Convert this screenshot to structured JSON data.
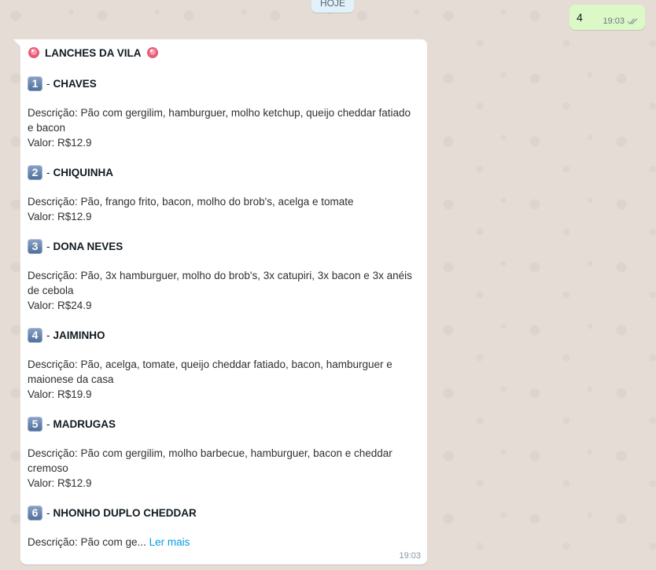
{
  "date_separator": "HOJE",
  "outgoing": {
    "text": "4",
    "time": "19:03",
    "status_icon": "double-check-icon"
  },
  "incoming": {
    "header": "LANCHES DA VILA",
    "header_icon": "siren-icon",
    "items": [
      {
        "number": "1",
        "dash": "-",
        "name": "CHAVES",
        "description": "Descrição: Pão com gergilim, hamburguer, molho ketchup, queijo cheddar fatiado e bacon",
        "price": "Valor: R$12.9"
      },
      {
        "number": "2",
        "dash": "-",
        "name": "CHIQUINHA",
        "description": "Descrição: Pão, frango frito, bacon, molho do brob's, acelga e tomate",
        "price": "Valor: R$12.9"
      },
      {
        "number": "3",
        "dash": "-",
        "name": "DONA NEVES",
        "description": "Descrição: Pão, 3x hamburguer, molho do brob's, 3x catupiri, 3x bacon e 3x anéis de cebola",
        "price": "Valor: R$24.9"
      },
      {
        "number": "4",
        "dash": "-",
        "name": "JAIMINHO",
        "description": "Descrição: Pão, acelga, tomate, queijo cheddar fatiado, bacon, hamburguer e maionese da casa",
        "price": "Valor: R$19.9"
      },
      {
        "number": "5",
        "dash": "-",
        "name": "MADRUGAS",
        "description": "Descrição: Pão com gergilim, molho barbecue, hamburguer, bacon e cheddar cremoso",
        "price": "Valor: R$12.9"
      },
      {
        "number": "6",
        "dash": "-",
        "name": "NHONHO DUPLO CHEDDAR",
        "description_truncated": "Descrição: Pão com ge...",
        "read_more": "Ler mais"
      }
    ],
    "time": "19:03"
  },
  "colors": {
    "wallpaper": "#e5ddd5",
    "outgoing_bubble": "#dcf8c6",
    "incoming_bubble": "#ffffff",
    "link": "#039be5"
  }
}
